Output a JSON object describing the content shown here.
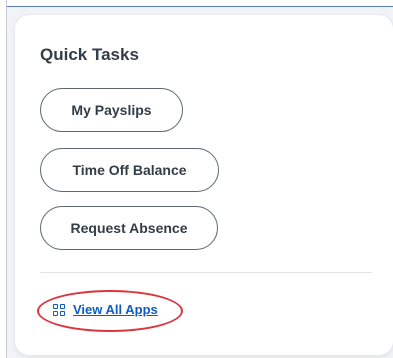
{
  "quick_tasks": {
    "title": "Quick Tasks",
    "buttons": [
      {
        "label": "My Payslips"
      },
      {
        "label": "Time Off Balance"
      },
      {
        "label": "Request Absence"
      }
    ],
    "view_all": {
      "label": "View All Apps",
      "icon": "apps-grid-icon",
      "color": "#0b5cc4"
    }
  },
  "colors": {
    "annotation": "#d9363e",
    "text": "#333d47",
    "button_border": "#5e6670"
  }
}
